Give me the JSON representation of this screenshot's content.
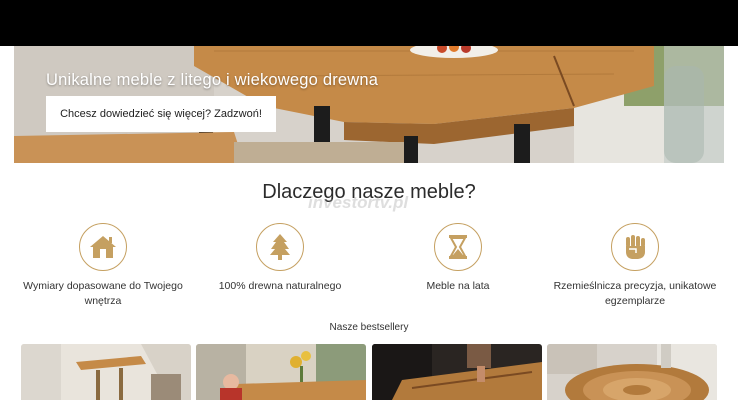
{
  "colors": {
    "accent": "#c5a061",
    "topbar": "#000000",
    "wood": "#c58a48"
  },
  "hero": {
    "title": "Unikalne meble z litego i wiekowego drewna",
    "cta": "Chcesz dowiedzieć się więcej? Zadzwoń!"
  },
  "why": {
    "title": "Dlaczego nasze meble?",
    "features": [
      {
        "icon": "house-icon",
        "label": "Wymiary dopasowane do Twojego wnętrza"
      },
      {
        "icon": "tree-icon",
        "label": "100% drewna naturalnego"
      },
      {
        "icon": "hourglass-icon",
        "label": "Meble na lata"
      },
      {
        "icon": "fist-icon",
        "label": "Rzemieślnicza precyzja, unikatowe egzemplarze"
      }
    ]
  },
  "watermark": "investortv.pl",
  "bestsellers": {
    "title": "Nasze bestsellery"
  }
}
